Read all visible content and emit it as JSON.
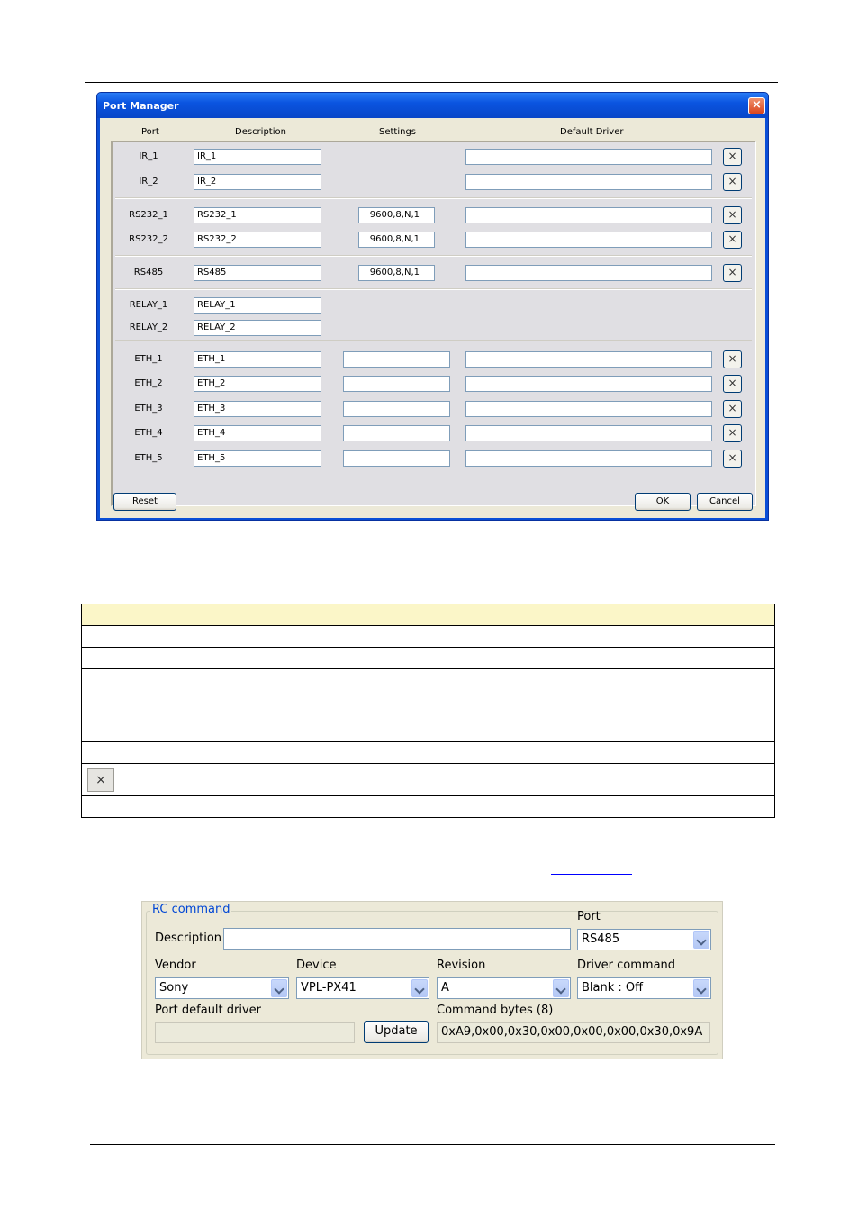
{
  "dialog": {
    "title": "Port Manager",
    "close_label": "×",
    "columns": {
      "port": "Port",
      "description": "Description",
      "settings": "Settings",
      "default_driver": "Default Driver"
    },
    "rows": [
      {
        "port": "IR_1",
        "description": "IR_1",
        "settings": null,
        "driver": "",
        "has_clear": true
      },
      {
        "port": "IR_2",
        "description": "IR_2",
        "settings": null,
        "driver": "",
        "has_clear": true
      },
      {
        "port": "RS232_1",
        "description": "RS232_1",
        "settings": "9600,8,N,1",
        "driver": "",
        "has_clear": true
      },
      {
        "port": "RS232_2",
        "description": "RS232_2",
        "settings": "9600,8,N,1",
        "driver": "",
        "has_clear": true
      },
      {
        "port": "RS485",
        "description": "RS485",
        "settings": "9600,8,N,1",
        "driver": "",
        "has_clear": true
      },
      {
        "port": "RELAY_1",
        "description": "RELAY_1",
        "settings": null,
        "driver": null,
        "has_clear": false
      },
      {
        "port": "RELAY_2",
        "description": "RELAY_2",
        "settings": null,
        "driver": null,
        "has_clear": false
      },
      {
        "port": "ETH_1",
        "description": "ETH_1",
        "settings": "",
        "driver": "",
        "has_clear": true
      },
      {
        "port": "ETH_2",
        "description": "ETH_2",
        "settings": "",
        "driver": "",
        "has_clear": true
      },
      {
        "port": "ETH_3",
        "description": "ETH_3",
        "settings": "",
        "driver": "",
        "has_clear": true
      },
      {
        "port": "ETH_4",
        "description": "ETH_4",
        "settings": "",
        "driver": "",
        "has_clear": true
      },
      {
        "port": "ETH_5",
        "description": "ETH_5",
        "settings": "",
        "driver": "",
        "has_clear": true
      }
    ],
    "clear_label": "×",
    "buttons": {
      "reset": "Reset",
      "ok": "OK",
      "cancel": "Cancel"
    }
  },
  "description_table": {
    "x_icon_label": "×"
  },
  "rc_command": {
    "legend": "RC command",
    "description_label": "Description",
    "description_value": "",
    "port_label": "Port",
    "port_value": "RS485",
    "vendor_label": "Vendor",
    "vendor_value": "Sony",
    "device_label": "Device",
    "device_value": "VPL-PX41",
    "revision_label": "Revision",
    "revision_value": "A",
    "driver_command_label": "Driver command",
    "driver_command_value": "Blank : Off",
    "port_default_driver_label": "Port default driver",
    "port_default_driver_value": "",
    "update_label": "Update",
    "command_bytes_label": "Command bytes (8)",
    "command_bytes_value": "0xA9,0x00,0x30,0x00,0x00,0x00,0x30,0x9A"
  }
}
